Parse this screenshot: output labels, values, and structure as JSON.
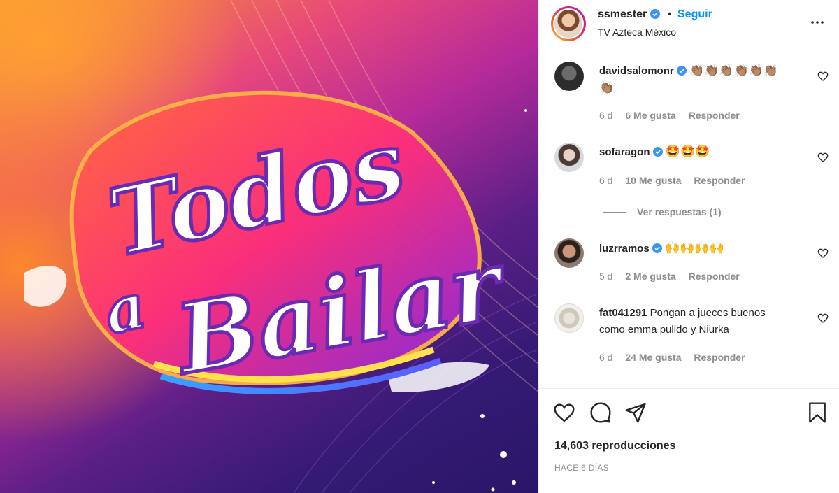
{
  "media": {
    "title_line1": "Todos",
    "title_line2": "a",
    "title_line3": "Bailar"
  },
  "header": {
    "username": "ssmester",
    "separator": "•",
    "follow_label": "Seguir",
    "location": "TV Azteca México",
    "more_icon": "more-horizontal-icon"
  },
  "comments": [
    {
      "username": "davidsalomonr",
      "verified": true,
      "text": "👏🏽👏🏽👏🏽👏🏽👏🏽👏🏽",
      "text2": "👏🏽",
      "time": "6 d",
      "likes": "6 Me gusta",
      "reply": "Responder"
    },
    {
      "username": "sofaragon",
      "verified": true,
      "text": "🤩🤩🤩",
      "time": "6 d",
      "likes": "10 Me gusta",
      "reply": "Responder",
      "view_replies": "Ver respuestas (1)"
    },
    {
      "username": "luzrramos",
      "verified": true,
      "text": "🙌🙌🙌🙌",
      "time": "5 d",
      "likes": "2 Me gusta",
      "reply": "Responder"
    },
    {
      "username": "fat041291",
      "verified": false,
      "text": "Pongan a jueces buenos",
      "text2": "como emma pulido y Niurka",
      "time": "6 d",
      "likes": "24 Me gusta",
      "reply": "Responder"
    }
  ],
  "actions": {
    "like_icon": "heart-icon",
    "comment_icon": "comment-icon",
    "share_icon": "paper-plane-icon",
    "save_icon": "bookmark-icon",
    "views": "14,603 reproducciones",
    "posted_ago": "HACE 6 DÍAS"
  },
  "colors": {
    "accent": "#0095f6",
    "verified": "#3897f0",
    "muted": "#8e8e8e",
    "text": "#262626"
  }
}
